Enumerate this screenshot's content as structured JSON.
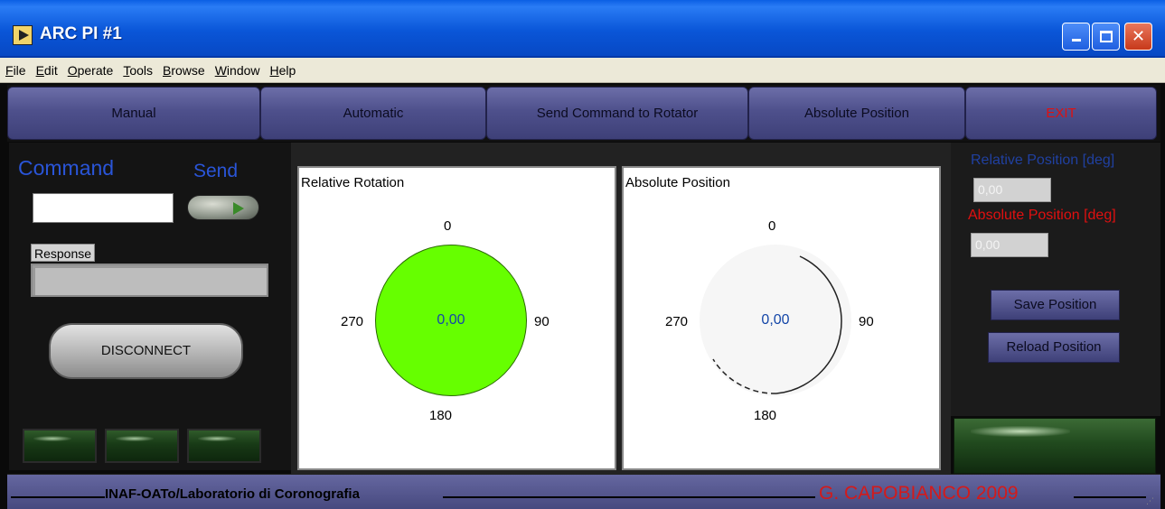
{
  "window": {
    "title": "ARC PI #1",
    "controls": {
      "minimize": "minimize-icon",
      "maximize": "maximize-icon",
      "close": "close-icon"
    }
  },
  "menu": [
    "File",
    "Edit",
    "Operate",
    "Tools",
    "Browse",
    "Window",
    "Help"
  ],
  "nav": {
    "manual": "Manual",
    "automatic": "Automatic",
    "send_command": "Send Command to Rotator",
    "absolute_position": "Absolute Position",
    "exit": "EXIT"
  },
  "left": {
    "command_label": "Command",
    "send_label": "Send",
    "command_value": "",
    "response_label": "Response",
    "response_value": "",
    "disconnect": "DISCONNECT"
  },
  "gauges": {
    "relative": {
      "title": "Relative Rotation",
      "value": "0,00",
      "ticks": [
        "0",
        "90",
        "180",
        "270"
      ]
    },
    "absolute": {
      "title": "Absolute Position",
      "value": "0,00",
      "ticks": [
        "0",
        "90",
        "180",
        "270"
      ]
    }
  },
  "right": {
    "relative_label": "Relative Position [deg]",
    "relative_value": "0,00",
    "absolute_label": "Absolute Position [deg]",
    "absolute_value": "0,00",
    "save": "Save Position",
    "reload": "Reload Position"
  },
  "footer": {
    "left": "INAF-OATo/Laboratorio di Coronografia",
    "right": "G. CAPOBIANCO 2009"
  },
  "colors": {
    "title_bar": "#0a56d8",
    "nav_button": "#4e508c",
    "exit_text": "#e01010",
    "label_blue": "#2a55d8",
    "dial_fill_relative": "#66ff00",
    "footer_bg": "#47497f",
    "author_red": "#d41a1a"
  }
}
